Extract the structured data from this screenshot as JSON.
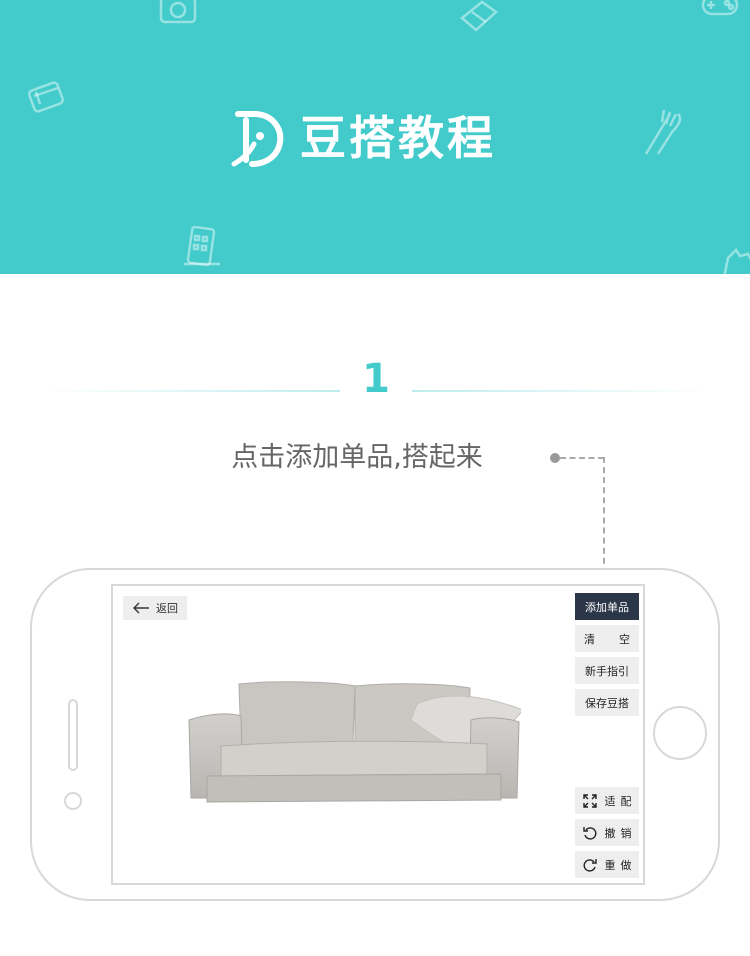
{
  "banner": {
    "background": "#43cbcb",
    "title": "豆搭教程",
    "logo_icon": "doudou-logo-icon",
    "decorative_icons": [
      "camera-icon",
      "ticket-icon",
      "gamepad-icon",
      "gift-icon",
      "utensils-icon",
      "building-icon",
      "hand-icon"
    ]
  },
  "step": {
    "number": "1",
    "description": "点击添加单品,搭起来",
    "accent": "#43cbcb"
  },
  "phone_screen": {
    "back_label": "返回",
    "toolbar": {
      "add_item": "添加单品",
      "clear": "清空",
      "guide": "新手指引",
      "save": "保存豆搭"
    },
    "bottom_tools": {
      "fit": "适配",
      "undo": "撤销",
      "redo": "重做"
    },
    "canvas_item": "sofa-image",
    "primary_color": "#2b3648"
  }
}
